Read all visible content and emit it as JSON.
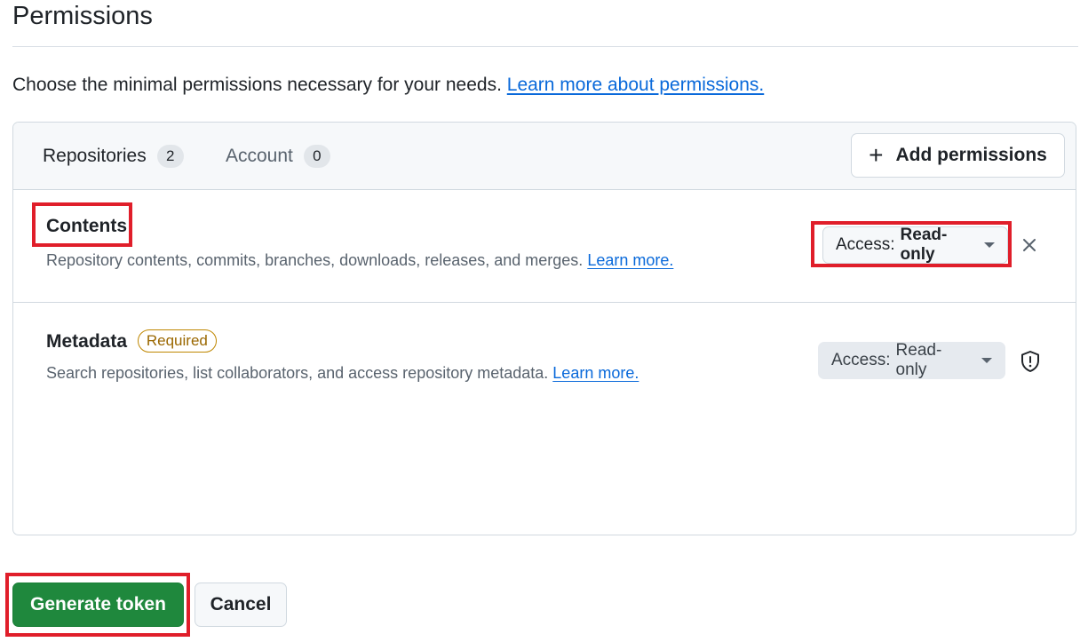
{
  "page": {
    "title": "Permissions",
    "intro_text": "Choose the minimal permissions necessary for your needs.",
    "intro_link": "Learn more about permissions."
  },
  "tabs": [
    {
      "label": "Repositories",
      "count": "2",
      "active": true
    },
    {
      "label": "Account",
      "count": "0",
      "active": false
    }
  ],
  "add_permissions_label": "Add permissions",
  "permissions": [
    {
      "name": "Contents",
      "description": "Repository contents, commits, branches, downloads, releases, and merges.",
      "learn_more": "Learn more.",
      "access_prefix": "Access:",
      "access_value": "Read-only",
      "action_icon": "close-icon"
    },
    {
      "name": "Metadata",
      "badge": "Required",
      "description": "Search repositories, list collaborators, and access repository metadata.",
      "learn_more": "Learn more.",
      "access_prefix": "Access:",
      "access_value": "Read-only",
      "action_icon": "shield-icon"
    }
  ],
  "actions": {
    "generate": "Generate token",
    "cancel": "Cancel"
  },
  "colors": {
    "primary_button": "#1f883d",
    "link": "#0969da",
    "highlight": "#e01e2a",
    "required_badge": "#9a6700"
  }
}
